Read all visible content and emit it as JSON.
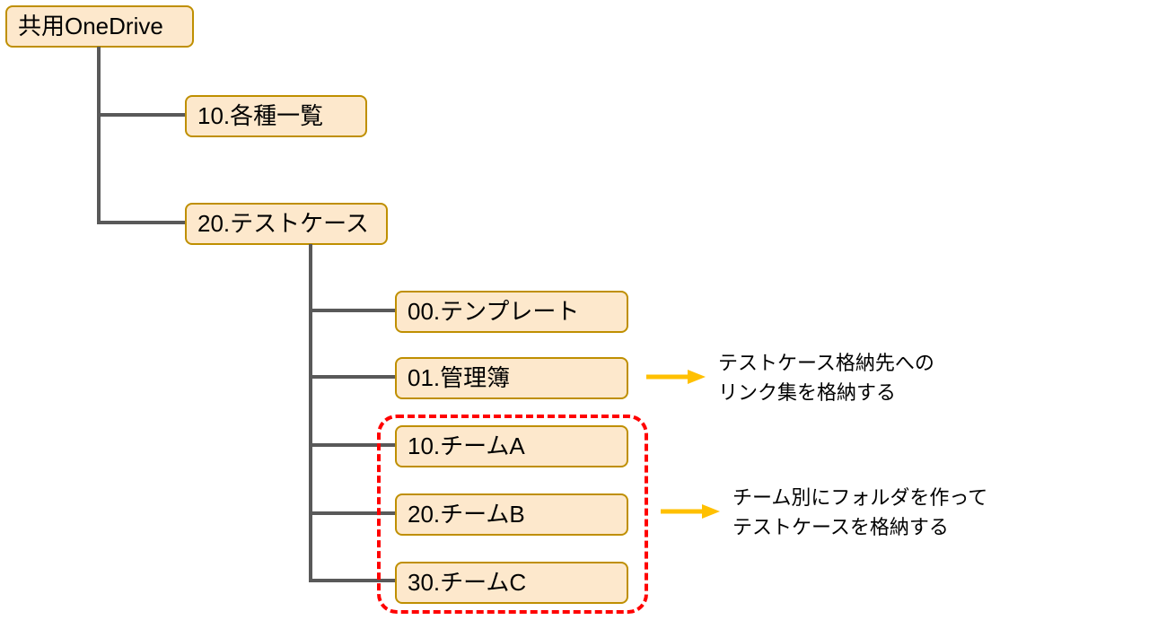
{
  "nodes": {
    "root": {
      "label": "共用OneDrive"
    },
    "n10": {
      "label": "10.各種一覧"
    },
    "n20": {
      "label": "20.テストケース"
    },
    "n20_00": {
      "label": "00.テンプレート"
    },
    "n20_01": {
      "label": "01.管理簿"
    },
    "n20_10": {
      "label": "10.チームA"
    },
    "n20_20": {
      "label": "20.チームB"
    },
    "n20_30": {
      "label": "30.チームC"
    }
  },
  "annotations": {
    "a1_line1": "テストケース格納先への",
    "a1_line2": "リンク集を格納する",
    "a2_line1": "チーム別にフォルダを作って",
    "a2_line2": "テストケースを格納する"
  },
  "colors": {
    "node_fill": "#fde8cc",
    "node_border": "#bf8f00",
    "connector": "#595959",
    "group_border": "#ff0000",
    "arrow": "#ffc000"
  }
}
